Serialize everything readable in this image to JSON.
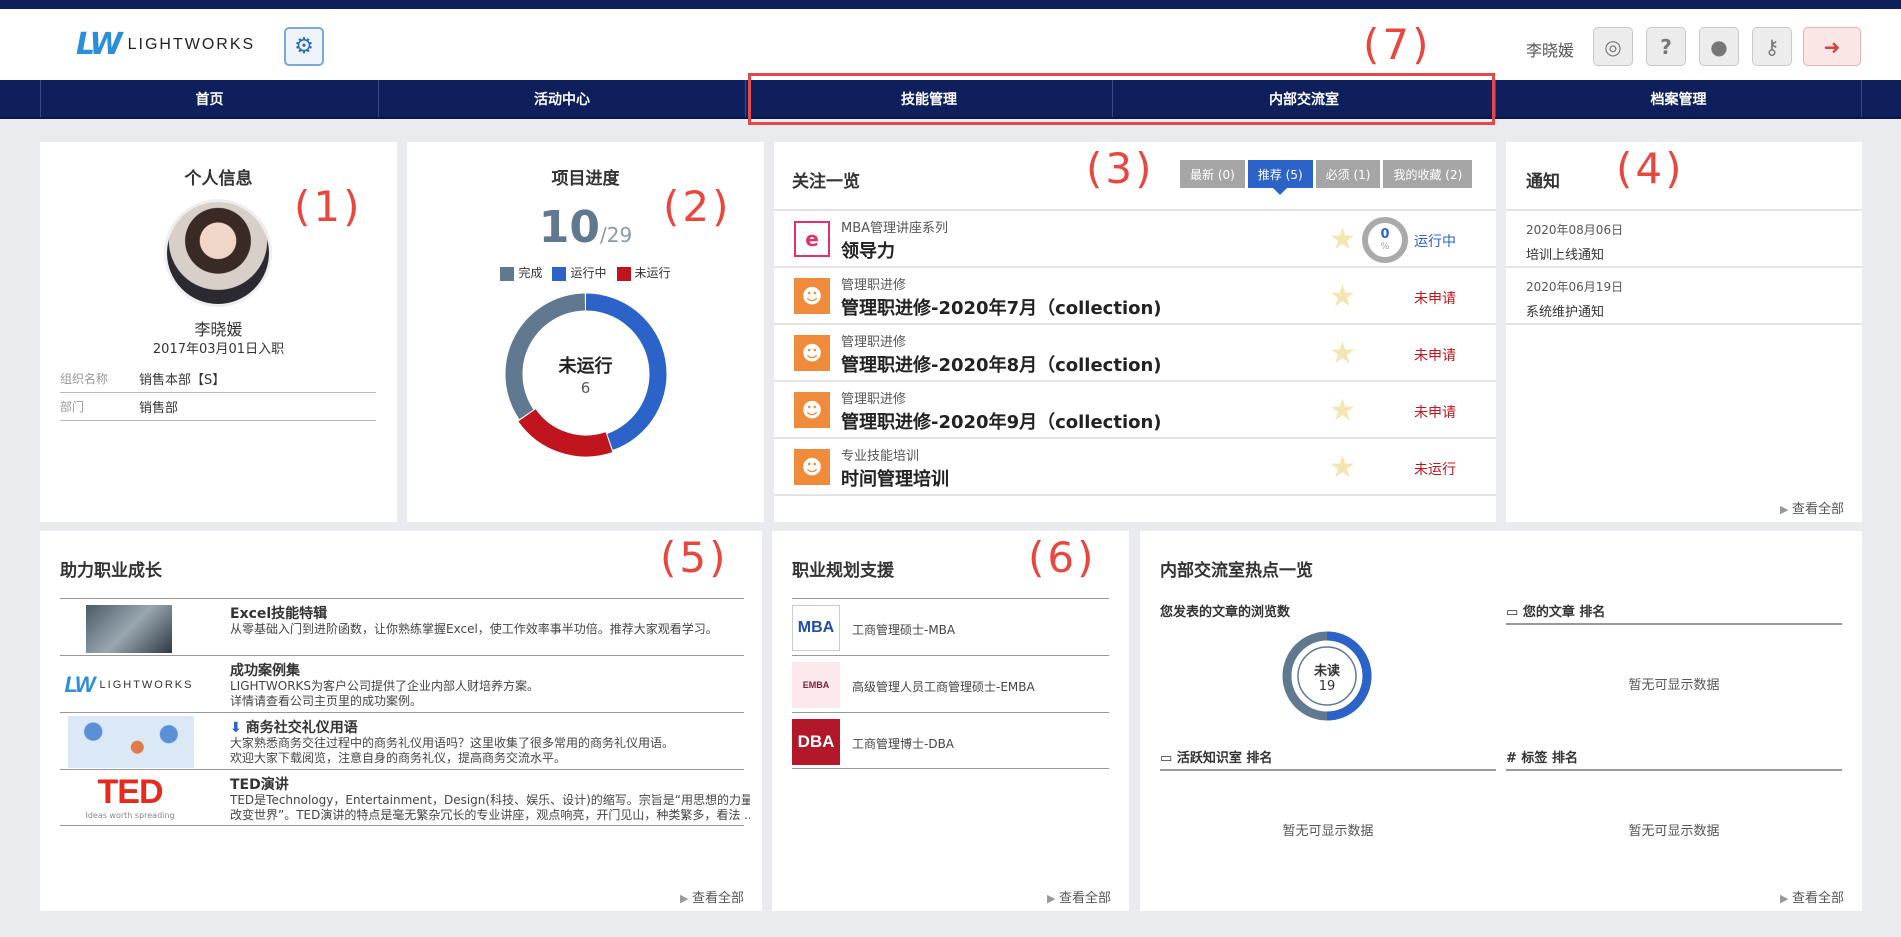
{
  "header": {
    "logo_mark": "LW",
    "logo_text": "LIGHTWORKS",
    "user_name": "李晓媛",
    "icons": [
      "globe-icon",
      "help-icon",
      "profile-icon",
      "key-icon",
      "logout-icon"
    ]
  },
  "nav": {
    "items": [
      {
        "label": "首页"
      },
      {
        "label": "活动中心"
      },
      {
        "label": "技能管理"
      },
      {
        "label": "内部交流室"
      },
      {
        "label": "档案管理"
      }
    ]
  },
  "annotations": [
    "(1)",
    "(2)",
    "(3)",
    "(4)",
    "(5)",
    "(6)",
    "(7)"
  ],
  "profile": {
    "title": "个人信息",
    "name": "李晓媛",
    "join_date": "2017年03月01日入职",
    "fields": [
      {
        "key": "组织名称",
        "value": "销售本部【S】"
      },
      {
        "key": "部门",
        "value": "销售部"
      }
    ]
  },
  "progress": {
    "title": "项目进度",
    "done": "10",
    "total": "/29",
    "legend": [
      {
        "label": "完成",
        "color": "#607890"
      },
      {
        "label": "运行中",
        "color": "#2c63c8"
      },
      {
        "label": "未运行",
        "color": "#c0141e"
      }
    ],
    "center_label": "未运行",
    "center_value": "6",
    "chart_data": {
      "type": "pie",
      "categories": [
        "完成",
        "运行中",
        "未运行"
      ],
      "values": [
        10,
        13,
        6
      ],
      "colors": [
        "#607890",
        "#2c63c8",
        "#c0141e"
      ]
    }
  },
  "follow": {
    "title": "关注一览",
    "tabs": [
      {
        "label": "最新 (0)",
        "active": false
      },
      {
        "label": "推荐 (5)",
        "active": true
      },
      {
        "label": "必须 (1)",
        "active": false
      },
      {
        "label": "我的收藏 (2)",
        "active": false
      }
    ],
    "items": [
      {
        "category": "MBA管理讲座系列",
        "name": "领导力",
        "status": "运行中",
        "status_color": "#2c63c8",
        "progress": "0",
        "progress_unit": "%",
        "icon": "elearning-icon"
      },
      {
        "category": "管理职进修",
        "name": "管理职进修-2020年7月（collection)",
        "status": "未申请",
        "status_color": "#c0141e",
        "icon": "group-icon"
      },
      {
        "category": "管理职进修",
        "name": "管理职进修-2020年8月（collection)",
        "status": "未申请",
        "status_color": "#c0141e",
        "icon": "group-icon"
      },
      {
        "category": "管理职进修",
        "name": "管理职进修-2020年9月（collection)",
        "status": "未申请",
        "status_color": "#c0141e",
        "icon": "group-icon"
      },
      {
        "category": "专业技能培训",
        "name": "时间管理培训",
        "status": "未运行",
        "status_color": "#c0141e",
        "icon": "group-icon"
      }
    ],
    "more": "查看全部"
  },
  "notice": {
    "title": "通知",
    "items": [
      {
        "date": "2020年08月06日",
        "text": "培训上线通知"
      },
      {
        "date": "2020年06月19日",
        "text": "系统维护通知"
      }
    ],
    "more": "查看全部"
  },
  "growth": {
    "title": "助力职业成长",
    "items": [
      {
        "title": "Excel技能特辑",
        "desc": [
          "从零基础入门到进阶函数，让你熟练掌握Excel，使工作效率事半功倍。推荐大家观看学习。"
        ]
      },
      {
        "title": "成功案例集",
        "desc": [
          "LIGHTWORKS为客户公司提供了企业内部人财培养方案。",
          "详情请查看公司主页里的成功案例。"
        ]
      },
      {
        "title": "商务社交礼仪用语",
        "desc": [
          "大家熟悉商务交往过程中的商务礼仪用语吗？这里收集了很多常用的商务礼仪用语。",
          "欢迎大家下载阅览，注意自身的商务礼仪，提高商务交流水平。"
        ]
      },
      {
        "title": "TED演讲",
        "desc": [
          "TED是Technology，Entertainment，Design(科技、娱乐、设计)的缩写。宗旨是“用思想的力量来",
          "改变世界”。TED演讲的特点是毫无繁杂冗长的专业讲座，观点响亮，开门见山，种类繁多，看法 ..."
        ]
      }
    ],
    "thumb_text": {
      "lw": "LIGHTWORKS",
      "ted": "TED",
      "ted_sub": "Ideas worth spreading"
    },
    "more": "查看全部"
  },
  "career": {
    "title": "职业规划支援",
    "items": [
      {
        "thumb": "MBA",
        "label": "工商管理硕士-MBA"
      },
      {
        "thumb": "EMBA",
        "label": "高级管理人员工商管理硕士-EMBA"
      },
      {
        "thumb": "DBA",
        "label": "工商管理博士-DBA"
      }
    ],
    "more": "查看全部"
  },
  "hot": {
    "title": "内部交流室热点一览",
    "views_title": "您发表的文章的浏览数",
    "donut_label": "未读",
    "donut_value": "19",
    "rank_article": "您的文章 排名",
    "rank_room": "活跃知识室 排名",
    "rank_tag": "# 标签 排名",
    "no_data": "暂无可显示数据",
    "more": "查看全部"
  }
}
